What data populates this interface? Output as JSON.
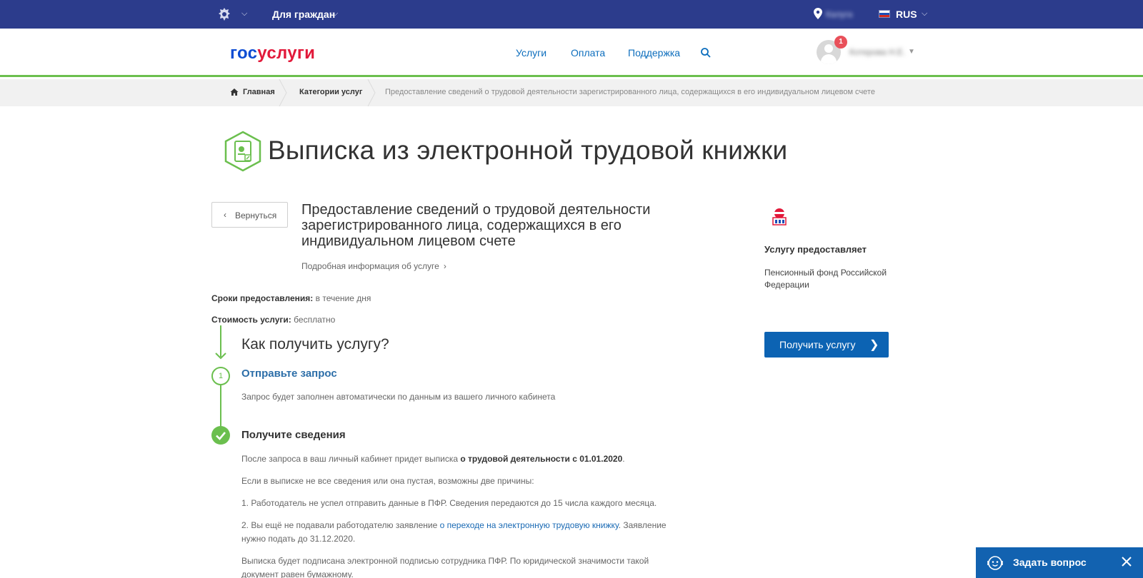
{
  "topbar": {
    "citizens": "Для граждан",
    "city": "Калуга",
    "lang": "RUS"
  },
  "header": {
    "logo_part1": "гос",
    "logo_part2": "услуги",
    "nav": [
      "Услуги",
      "Оплата",
      "Поддержка"
    ],
    "notification_count": "1",
    "username": "Котерова Н.Е."
  },
  "breadcrumb": {
    "home": "Главная",
    "categories": "Категории услуг",
    "current": "Предоставление сведений о трудовой деятельности зарегистрированного лица, содержащихся в его индивидуальном лицевом счете"
  },
  "page": {
    "title": "Выписка из электронной трудовой книжки",
    "back": "Вернуться",
    "service_title": "Предоставление сведений о трудовой деятельности зарегистрированного лица, содержащихся в его индивидуальном лицевом счете",
    "more_info": "Подробная информация об услуге",
    "terms_label": "Сроки предоставления:",
    "terms_value": "в течение дня",
    "cost_label": "Стоимость услуги:",
    "cost_value": "бесплатно"
  },
  "steps": {
    "how": "Как получить услугу?",
    "step1_num": "1",
    "step1_title": "Отправьте запрос",
    "step1_text": "Запрос будет заполнен автоматически по данным из вашего личного кабинета",
    "step2_title": "Получите сведения",
    "p1_text": "После запроса в ваш личный кабинет придет выписка ",
    "p1_bold": "о трудовой деятельности с 01.01.2020",
    "p1_end": ".",
    "p2": "Если в выписке не все сведения или она пустая, возможны две причины:",
    "p3": "1. Работодатель не успел отправить данные в ПФР. Сведения передаются до 15 числа каждого месяца.",
    "p4_start": "2. Вы ещё не подавали работодателю заявление ",
    "p4_link": "о переходе на электронную трудовую книжку",
    "p4_end": ". Заявление нужно подать до 31.12.2020.",
    "p5": "Выписка будет подписана электронной подписью сотрудника ПФР. По юридической значимости такой документ равен бумажному."
  },
  "sidebar": {
    "provider_label": "Услугу предоставляет",
    "provider_name": "Пенсионный фонд Российской Федерации",
    "get_service": "Получить услугу"
  },
  "widget": {
    "ask": "Задать вопрос"
  },
  "colors": {
    "topbar": "#2c3c8c",
    "accent_green": "#6bbf4e",
    "primary_button": "#0c63b3",
    "link": "#0d6ebd"
  }
}
